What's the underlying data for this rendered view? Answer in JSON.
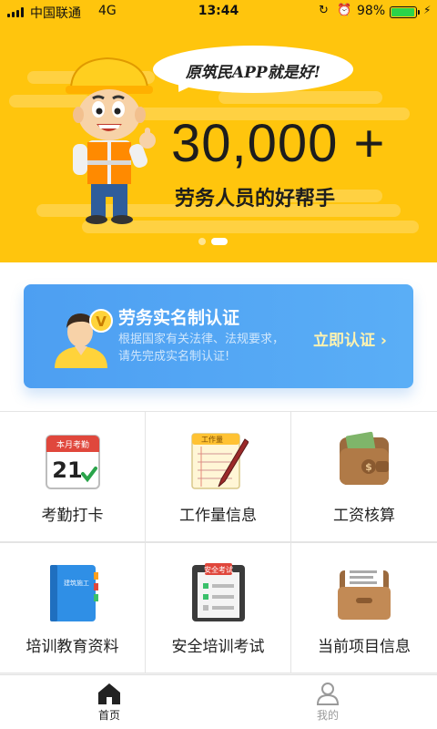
{
  "status_bar": {
    "carrier": "中国联通",
    "network": "4G",
    "time": "13:44",
    "battery_percent": "98%",
    "battery_level": 0.98
  },
  "banner": {
    "bubble_text": "原筑民APP就是好!",
    "headline": "30,000 +",
    "subline": "劳务人员的好帮手",
    "page_indicator": {
      "count": 2,
      "active_index": 1
    }
  },
  "verify_card": {
    "title": "劳务实名制认证",
    "description": "根据国家有关法律、法规要求，请先完成实名制认证!",
    "action_label": "立即认证",
    "badge_letter": "V"
  },
  "features": [
    {
      "label": "考勤打卡",
      "icon": "calendar-icon",
      "icon_header": "本月考勤",
      "icon_number": "21"
    },
    {
      "label": "工作量信息",
      "icon": "notepad-icon",
      "icon_header": "工作量"
    },
    {
      "label": "工资核算",
      "icon": "wallet-icon",
      "icon_header": ""
    },
    {
      "label": "培训教育资料",
      "icon": "book-icon",
      "icon_header": "建筑施工"
    },
    {
      "label": "安全培训考试",
      "icon": "clipboard-icon",
      "icon_header": "安全考试"
    },
    {
      "label": "当前项目信息",
      "icon": "folder-icon",
      "icon_header": ""
    }
  ],
  "tabbar": {
    "items": [
      {
        "label": "首页",
        "icon": "home-icon",
        "active": true
      },
      {
        "label": "我的",
        "icon": "profile-icon",
        "active": false
      }
    ]
  },
  "colors": {
    "banner_yellow": "#ffc50d",
    "card_blue": "#4d9ff2",
    "verify_text": "#fff3b0",
    "tab_active": "#222222",
    "tab_inactive": "#9a9a9a"
  }
}
